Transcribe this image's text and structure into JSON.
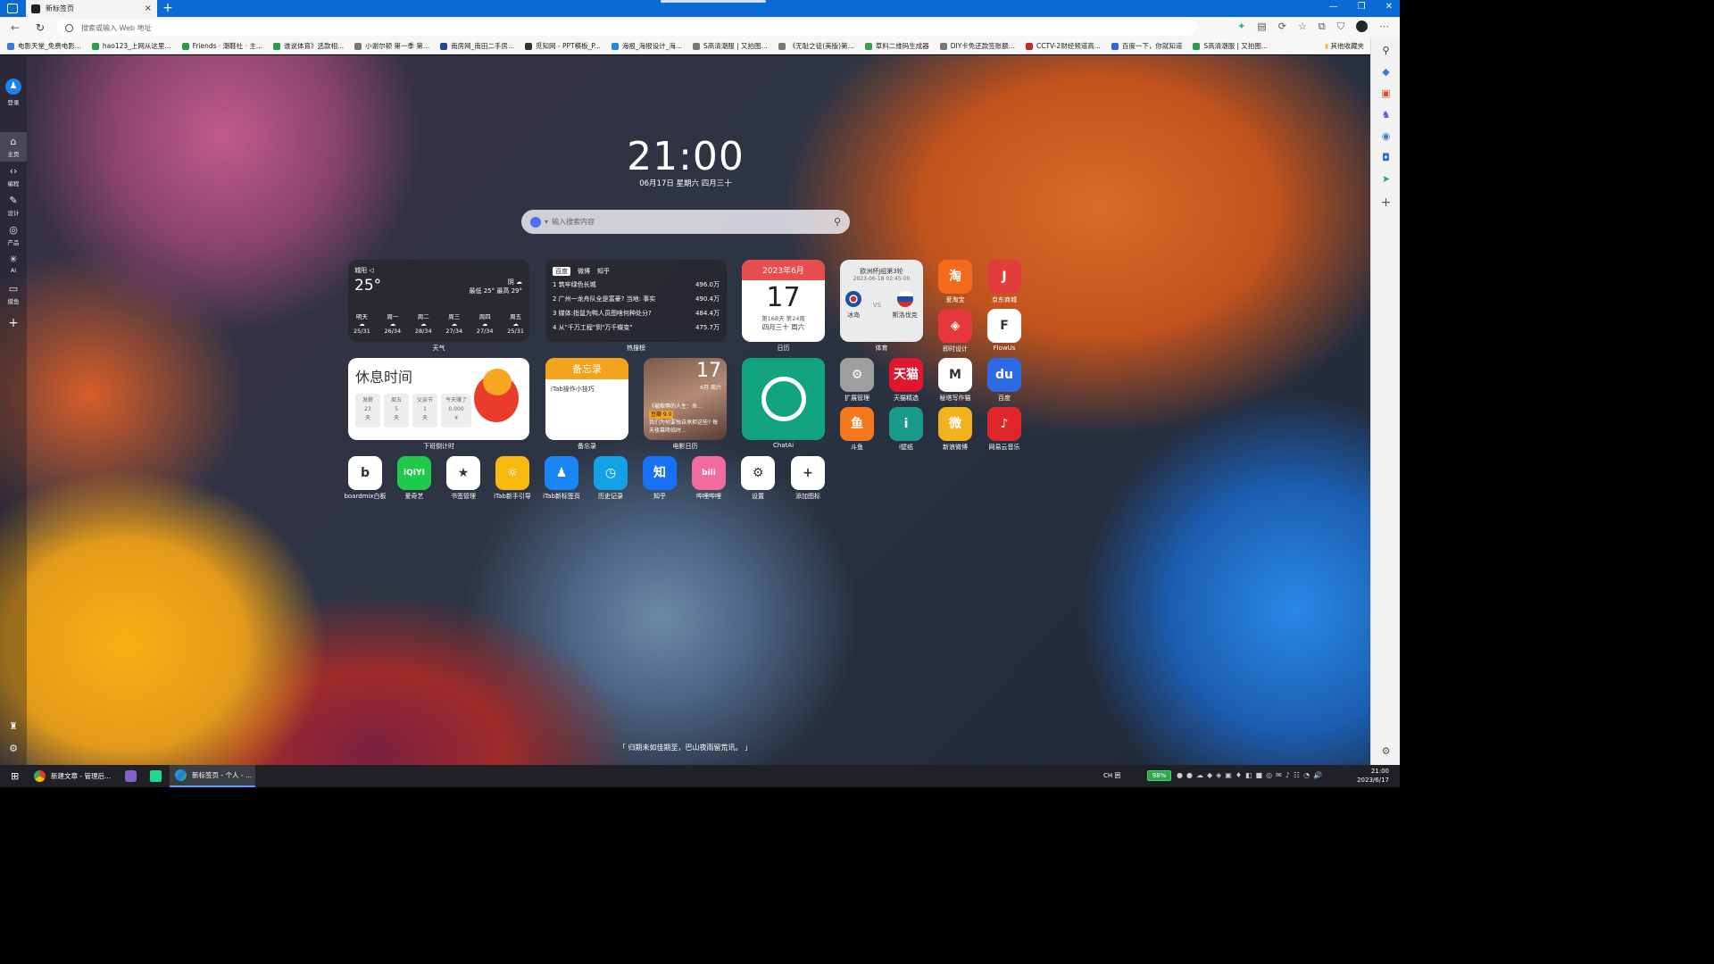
{
  "browser": {
    "tab_title": "新标签页",
    "address_placeholder": "搜索或输入 Web 地址",
    "bookmarks": [
      {
        "label": "电影天堂_免费电影...",
        "color": "#3b7ddd"
      },
      {
        "label": "hao123_上网从这里...",
        "color": "#2e9d4a"
      },
      {
        "label": "Friends · 潮鞋社 · 主...",
        "color": "#2b9a4b"
      },
      {
        "label": "谁说体育》选款相...",
        "color": "#2b9a4b"
      },
      {
        "label": "小谢尔顿 第一季 第...",
        "color": "#777"
      },
      {
        "label": "南房网_南田二手房...",
        "color": "#2345a0"
      },
      {
        "label": "觅知网 - PPT模板_P...",
        "color": "#333"
      },
      {
        "label": "海报_海报设计_海...",
        "color": "#1e88e5"
      },
      {
        "label": "S高清潮服 | 又拍图...",
        "color": "#777"
      },
      {
        "label": "《无耻之徒(美版)第...",
        "color": "#777"
      },
      {
        "label": "草料二维码生成器",
        "color": "#35a34a"
      },
      {
        "label": "DIY卡免还款签账额...",
        "color": "#777"
      },
      {
        "label": "CCTV-2财经频道高...",
        "color": "#c62828"
      },
      {
        "label": "百度一下，你就知道",
        "color": "#3464e0"
      },
      {
        "label": "S高清潮服 | 又拍图...",
        "color": "#2b9a4b"
      }
    ],
    "other_bookmarks": "其他收藏夹"
  },
  "left_sidebar": {
    "login": "登录",
    "items": [
      {
        "label": "主页",
        "icon": "home-icon",
        "glyph": "⌂"
      },
      {
        "label": "编程",
        "icon": "code-icon",
        "glyph": "‹›"
      },
      {
        "label": "设计",
        "icon": "pen-icon",
        "glyph": "✎"
      },
      {
        "label": "产品",
        "icon": "product-icon",
        "glyph": "◎"
      },
      {
        "label": "AI",
        "icon": "ai-icon",
        "glyph": "✳"
      },
      {
        "label": "摸鱼",
        "icon": "fish-icon",
        "glyph": "▭"
      }
    ]
  },
  "clock": {
    "time": "21:00",
    "date": "06月17日   星期六   四月三十"
  },
  "search": {
    "placeholder": "输入搜索内容"
  },
  "widgets": {
    "weather": {
      "city": "城阳 ◁",
      "temp": "25°",
      "condition": "阴",
      "range": "最低 25° 最高 29°",
      "days": [
        {
          "d": "明天",
          "t": "25/31"
        },
        {
          "d": "周一",
          "t": "26/34"
        },
        {
          "d": "周二",
          "t": "28/34"
        },
        {
          "d": "周三",
          "t": "27/34"
        },
        {
          "d": "周四",
          "t": "27/34"
        },
        {
          "d": "周五",
          "t": "25/31"
        }
      ],
      "label": "天气"
    },
    "hot": {
      "tabs": [
        "百度",
        "微博",
        "知乎"
      ],
      "items": [
        {
          "t": "1 筑牢绿色长城",
          "v": "496.0万"
        },
        {
          "t": "2 广州一龙舟队全是富豪? 当地: 事实",
          "v": "490.4万"
        },
        {
          "t": "3 媒体:指鼠为鸭人员图啥何种处分?",
          "v": "484.4万"
        },
        {
          "t": "4 从\"千万工程\"到\"万千蝶变\"",
          "v": "475.7万"
        }
      ],
      "label": "热搜榜"
    },
    "calendar": {
      "month": "2023年6月",
      "day": "17",
      "sub": "第168天 第24周",
      "lunar": "四月三十 周六",
      "label": "日历"
    },
    "sport": {
      "title": "欧洲杯J组第3轮",
      "time": "2023-06-18 02:45:00",
      "team1": "冰岛",
      "team2": "斯洛伐克",
      "vs": "VS",
      "label": "体育"
    },
    "rest": {
      "title": "休息时间",
      "boxes": [
        {
          "a": "发薪",
          "b": "23",
          "c": "天"
        },
        {
          "a": "周五",
          "b": "5",
          "c": "天"
        },
        {
          "a": "父亲节",
          "b": "1",
          "c": "天"
        },
        {
          "a": "今天赚了",
          "b": "0.000",
          "c": "¥"
        }
      ],
      "label": "下班倒计时"
    },
    "memo": {
      "title": "备忘录",
      "text": "iTab操作小技巧",
      "label": "备忘录"
    },
    "movie": {
      "day": "17",
      "week": "6月 周六",
      "text": "《被欺辱的人生：命...",
      "text2": "我们为何要独自承担这些? 每天夜幕降临时...",
      "score": "豆瓣 9.0",
      "label": "电影日历"
    },
    "chatai": {
      "label": "ChatAi"
    }
  },
  "apps": [
    {
      "label": "爱淘宝",
      "glyph": "淘",
      "color": "#f46a1d"
    },
    {
      "label": "京东商城",
      "glyph": "J",
      "color": "#e23c3c"
    },
    {
      "label": "即时设计",
      "glyph": "◈",
      "color": "#e5383b"
    },
    {
      "label": "FlowUs",
      "glyph": "F",
      "color": "#ffffff"
    },
    {
      "label": "扩展管理",
      "glyph": "⚙",
      "color": "#9e9e9e"
    },
    {
      "label": "天猫精选",
      "glyph": "天猫",
      "color": "#e1162f"
    },
    {
      "label": "秘塔写作猫",
      "glyph": "M",
      "color": "#ffffff"
    },
    {
      "label": "百度",
      "glyph": "du",
      "color": "#2f6ae6"
    },
    {
      "label": "斗鱼",
      "glyph": "鱼",
      "color": "#f5781d"
    },
    {
      "label": "i壁纸",
      "glyph": "i",
      "color": "#1a9a8b"
    },
    {
      "label": "新浪微博",
      "glyph": "微",
      "color": "#f3b21c"
    },
    {
      "label": "网易云音乐",
      "glyph": "♪",
      "color": "#e0262a"
    },
    {
      "label": "boardmix白板",
      "glyph": "b",
      "color": "#ffffff"
    },
    {
      "label": "爱奇艺",
      "glyph": "iQIYI",
      "color": "#1ec94c"
    },
    {
      "label": "书签管理",
      "glyph": "★",
      "color": "#ffffff"
    },
    {
      "label": "iTab新手引导",
      "glyph": "☼",
      "color": "#f7b90f"
    },
    {
      "label": "iTab新标签页",
      "glyph": "♟",
      "color": "#1a86f5"
    },
    {
      "label": "历史记录",
      "glyph": "◷",
      "color": "#13a2e6"
    },
    {
      "label": "知乎",
      "glyph": "知",
      "color": "#1772f6"
    },
    {
      "label": "哔哩哔哩",
      "glyph": "bili",
      "color": "#f26b9e"
    },
    {
      "label": "设置",
      "glyph": "⚙",
      "color": "#ffffff"
    },
    {
      "label": "添加图标",
      "glyph": "+",
      "color": "#ffffff"
    }
  ],
  "quote": "「 归期未如佳期至，巴山夜雨留荒讯。 」",
  "taskbar": {
    "items": [
      "新建文章 - 管理后...",
      "",
      "",
      "新标签页 - 个人 - ..."
    ],
    "battery": "98%",
    "time": "21:00",
    "date": "2023/6/17",
    "ime": "CH 囲"
  }
}
